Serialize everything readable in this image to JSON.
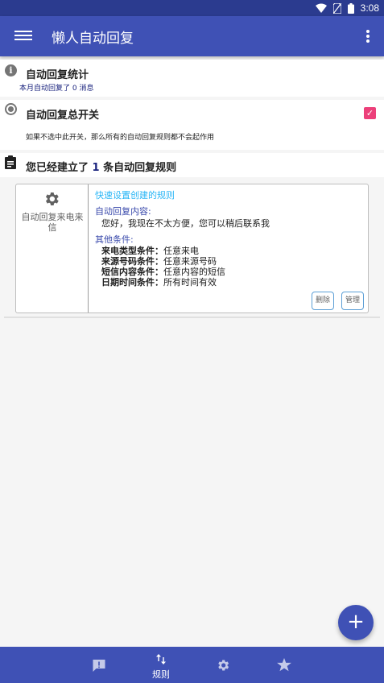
{
  "status_bar": {
    "time": "3:08"
  },
  "app_bar": {
    "title": "懒人自动回复"
  },
  "stats": {
    "title": "自动回复统计",
    "subtitle": "本月自动回复了 0 消息"
  },
  "master_switch": {
    "title": "自动回复总开关",
    "description": "如果不选中此开关，那么所有的自动回复规则都不会起作用",
    "checked": true
  },
  "rules_header": {
    "prefix": "您已经建立了",
    "count": "1",
    "suffix": "条自动回复规则"
  },
  "rule": {
    "type": "自动回复来电来信",
    "name": "快速设置创建的规则",
    "content_label": "自动回复内容:",
    "content": "您好，我现在不太方便，您可以稍后联系我",
    "other_label": "其他条件:",
    "conditions": [
      {
        "label": "来电类型条件：",
        "value": "任意来电"
      },
      {
        "label": "来源号码条件：",
        "value": "任意来源号码"
      },
      {
        "label": "短信内容条件：",
        "value": "任意内容的短信"
      },
      {
        "label": "日期时间条件：",
        "value": "所有时间有效"
      }
    ],
    "delete_label": "删除",
    "manage_label": "管理"
  },
  "fab": {
    "label": "+"
  },
  "bottom_nav": {
    "items": [
      {
        "icon": "feedback-icon",
        "label": ""
      },
      {
        "icon": "swap-vert-icon",
        "label": "规则"
      },
      {
        "icon": "settings-icon",
        "label": ""
      },
      {
        "icon": "star-icon",
        "label": ""
      }
    ]
  },
  "colors": {
    "primary": "#3f51b5",
    "status_bar": "#2b3b8f",
    "checkbox": "#ec407a",
    "link": "#29b6f6",
    "label": "#3949ab"
  }
}
